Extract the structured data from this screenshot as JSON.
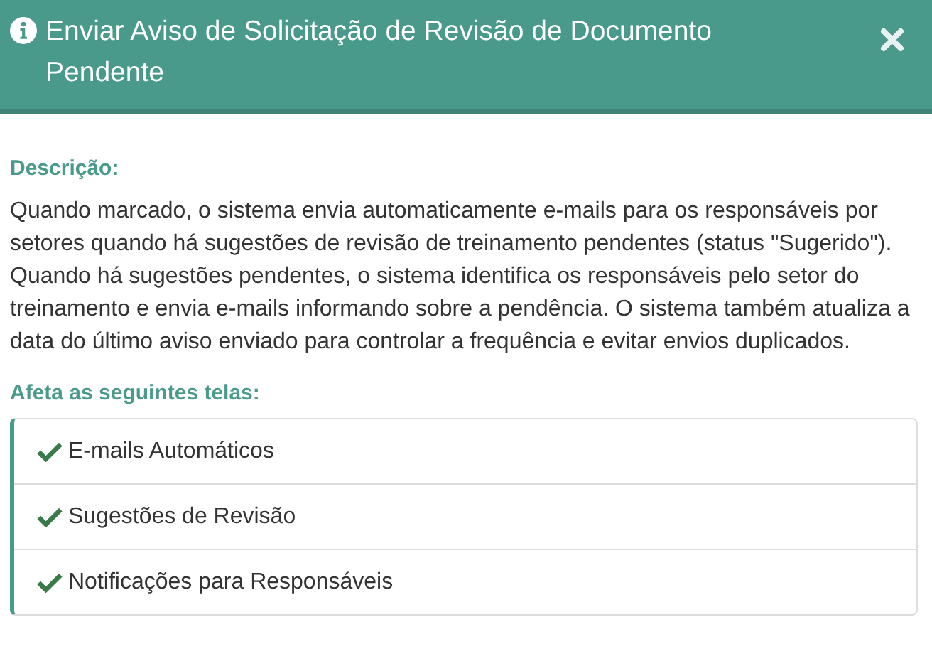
{
  "dialog": {
    "title": "Enviar Aviso de Solicitação de Revisão de Documento Pendente"
  },
  "description": {
    "label": "Descrição:",
    "text": "Quando marcado, o sistema envia automaticamente e-mails para os responsáveis por setores quando há sugestões de revisão de treinamento pendentes (status \"Sugerido\"). Quando há sugestões pendentes, o sistema identifica os responsáveis pelo setor do treinamento e envia e-mails informando sobre a pendência. O sistema também atualiza a data do último aviso enviado para controlar a frequência e evitar envios duplicados."
  },
  "affected": {
    "label": "Afeta as seguintes telas:",
    "items": [
      {
        "label": "E-mails Automáticos"
      },
      {
        "label": "Sugestões de Revisão"
      },
      {
        "label": "Notificações para Responsáveis"
      }
    ]
  }
}
